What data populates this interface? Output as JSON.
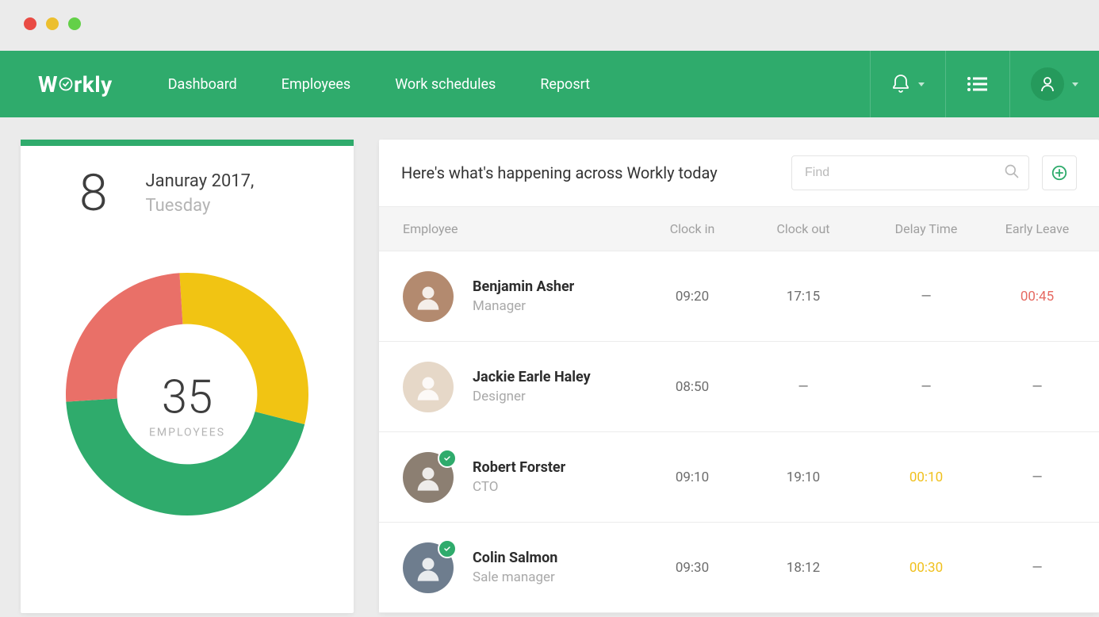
{
  "brand": "Workly",
  "nav": {
    "items": [
      "Dashboard",
      "Employees",
      "Work schedules",
      "Reposrt"
    ]
  },
  "date_card": {
    "day": "8",
    "month_year": "Januray 2017,",
    "weekday": "Tuesday"
  },
  "chart_data": {
    "type": "pie",
    "title": "Employees",
    "center_value": 35,
    "center_label": "EMPLOYEES",
    "series": [
      {
        "name": "green",
        "value": 45,
        "color": "#2fab6c"
      },
      {
        "name": "yellow",
        "value": 30,
        "color": "#f1c413"
      },
      {
        "name": "red",
        "value": 25,
        "color": "#e97068"
      }
    ]
  },
  "feed": {
    "title": "Here's what's happening across Workly today",
    "search_placeholder": "Find",
    "columns": [
      "Employee",
      "Clock in",
      "Clock out",
      "Delay Time",
      "Early Leave"
    ],
    "rows": [
      {
        "name": "Benjamin Asher",
        "role": "Manager",
        "clock_in": "09:20",
        "clock_out": "17:15",
        "delay": "—",
        "delay_class": "",
        "early": "00:45",
        "early_class": "err",
        "badge": false,
        "avatar": "#b38a6f"
      },
      {
        "name": "Jackie Earle Haley",
        "role": "Designer",
        "clock_in": "08:50",
        "clock_out": "—",
        "delay": "—",
        "delay_class": "",
        "early": "—",
        "early_class": "",
        "badge": false,
        "avatar": "#e6d8c8"
      },
      {
        "name": "Robert Forster",
        "role": "CTO",
        "clock_in": "09:10",
        "clock_out": "19:10",
        "delay": "00:10",
        "delay_class": "warn",
        "early": "—",
        "early_class": "",
        "badge": true,
        "avatar": "#8c7f72"
      },
      {
        "name": "Colin Salmon",
        "role": "Sale manager",
        "clock_in": "09:30",
        "clock_out": "18:12",
        "delay": "00:30",
        "delay_class": "warn",
        "early": "—",
        "early_class": "",
        "badge": true,
        "avatar": "#6e7d8e"
      }
    ]
  }
}
